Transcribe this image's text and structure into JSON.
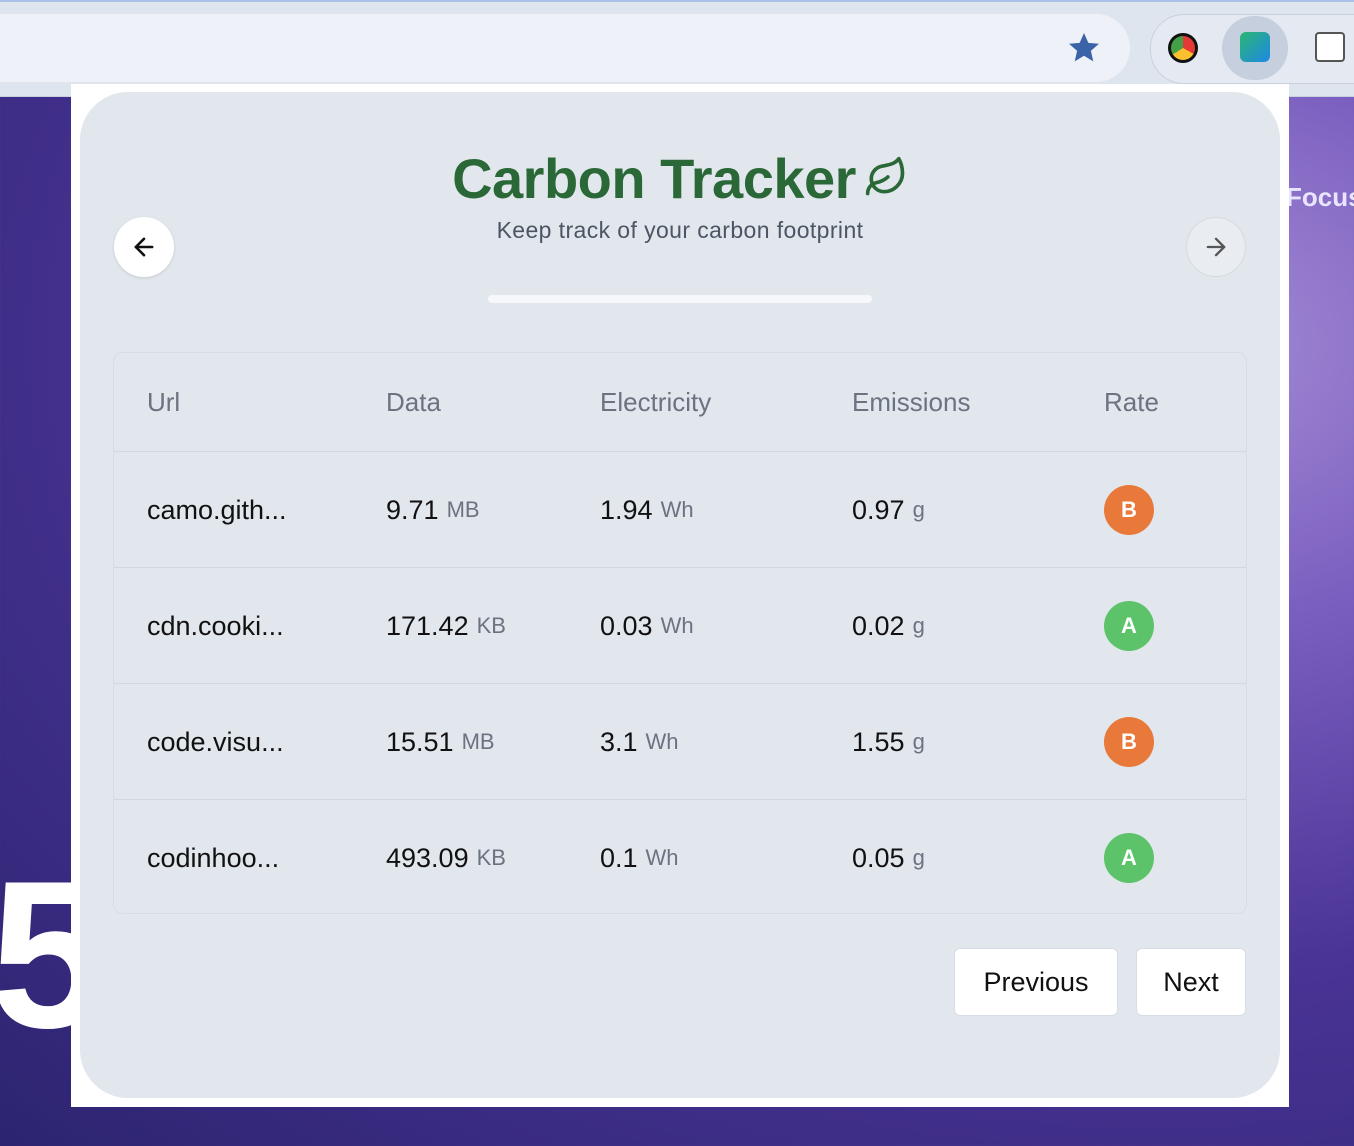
{
  "popup": {
    "title": "Carbon Tracker",
    "subtitle": "Keep track of your carbon footprint",
    "progress": 1.0
  },
  "background_page": {
    "right_text": "Focus",
    "left_text": "5"
  },
  "table": {
    "headers": [
      "Url",
      "Data",
      "Electricity",
      "Emissions",
      "Rate"
    ],
    "rows": [
      {
        "url": "camo.gith...",
        "data": "9.71",
        "data_unit": "MB",
        "electricity": "1.94",
        "electricity_unit": "Wh",
        "emissions": "0.97",
        "emissions_unit": "g",
        "rate": "B"
      },
      {
        "url": "cdn.cooki...",
        "data": "171.42",
        "data_unit": "KB",
        "electricity": "0.03",
        "electricity_unit": "Wh",
        "emissions": "0.02",
        "emissions_unit": "g",
        "rate": "A"
      },
      {
        "url": "code.visu...",
        "data": "15.51",
        "data_unit": "MB",
        "electricity": "3.1",
        "electricity_unit": "Wh",
        "emissions": "1.55",
        "emissions_unit": "g",
        "rate": "B"
      },
      {
        "url": "codinhoo...",
        "data": "493.09",
        "data_unit": "KB",
        "electricity": "0.1",
        "electricity_unit": "Wh",
        "emissions": "0.05",
        "emissions_unit": "g",
        "rate": "A"
      }
    ]
  },
  "pagination": {
    "previous_label": "Previous",
    "next_label": "Next"
  },
  "colors": {
    "title_green": "#2b6837",
    "rate_a": "#5cc36a",
    "rate_b": "#e8793a"
  },
  "icons": {
    "star": "star-icon",
    "back": "arrow-left-icon",
    "forward": "arrow-right-icon",
    "leaf": "leaf-icon"
  }
}
